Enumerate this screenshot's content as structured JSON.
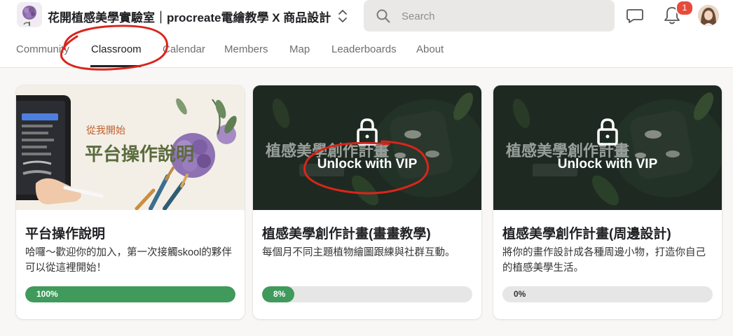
{
  "header": {
    "group_title": "花開植感美學實驗室｜procreate電繪教學 X 商品設計",
    "search_placeholder": "Search",
    "notification_count": "1"
  },
  "tabs": [
    {
      "label": "Community",
      "active": false
    },
    {
      "label": "Classroom",
      "active": true
    },
    {
      "label": "Calendar",
      "active": false
    },
    {
      "label": "Members",
      "active": false
    },
    {
      "label": "Map",
      "active": false
    },
    {
      "label": "Leaderboards",
      "active": false
    },
    {
      "label": "About",
      "active": false
    }
  ],
  "courses": [
    {
      "title": "平台操作說明",
      "description": "哈囉～歡迎你的加入，第一次接觸skool的夥伴可以從這裡開始！",
      "progress": 1.0,
      "progress_label": "100%",
      "locked": false,
      "cover_text_small": "從我開始",
      "cover_text_large": "平台操作說明"
    },
    {
      "title": "植感美學創作計畫(畫畫教學)",
      "description": "每個月不同主題植物繪圖跟練與社群互動。",
      "progress": 0.08,
      "progress_label": "8%",
      "locked": true,
      "unlock_label": "Unlock with VIP",
      "cover_text_large": "植感美學創作計畫"
    },
    {
      "title": "植感美學創作計畫(周邊設計)",
      "description": "將你的畫作設計成各種周邊小物，打造你自己的植感美學生活。",
      "progress": 0.0,
      "progress_label": "0%",
      "locked": true,
      "unlock_label": "Unlock with VIP",
      "cover_text_large": "植感美學創作計畫"
    }
  ],
  "colors": {
    "accent_green": "#3f9a5c",
    "badge_red": "#e54c3c",
    "annotation_red": "#d9251c"
  }
}
